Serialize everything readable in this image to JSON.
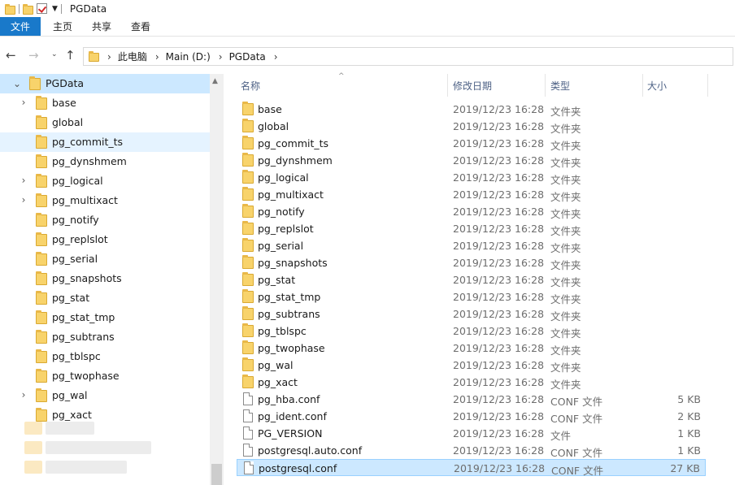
{
  "window": {
    "title": "PGData"
  },
  "ribbon": {
    "tabs": [
      "文件",
      "主页",
      "共享",
      "查看"
    ]
  },
  "address": {
    "crumbs": [
      "此电脑",
      "Main (D:)",
      "PGData"
    ]
  },
  "colors": {
    "accent": "#1979ca",
    "selection": "#cce8ff",
    "folder": "#f8d36b"
  },
  "nav_pane": {
    "root": "PGData",
    "items": [
      {
        "label": "base",
        "expandable": true
      },
      {
        "label": "global",
        "expandable": false
      },
      {
        "label": "pg_commit_ts",
        "expandable": false,
        "hover": true
      },
      {
        "label": "pg_dynshmem",
        "expandable": false
      },
      {
        "label": "pg_logical",
        "expandable": true
      },
      {
        "label": "pg_multixact",
        "expandable": true
      },
      {
        "label": "pg_notify",
        "expandable": false
      },
      {
        "label": "pg_replslot",
        "expandable": false
      },
      {
        "label": "pg_serial",
        "expandable": false
      },
      {
        "label": "pg_snapshots",
        "expandable": false
      },
      {
        "label": "pg_stat",
        "expandable": false
      },
      {
        "label": "pg_stat_tmp",
        "expandable": false
      },
      {
        "label": "pg_subtrans",
        "expandable": false
      },
      {
        "label": "pg_tblspc",
        "expandable": false
      },
      {
        "label": "pg_twophase",
        "expandable": false
      },
      {
        "label": "pg_wal",
        "expandable": true
      },
      {
        "label": "pg_xact",
        "expandable": false
      }
    ]
  },
  "columns": [
    "名称",
    "修改日期",
    "类型",
    "大小"
  ],
  "files": [
    {
      "name": "base",
      "date": "2019/12/23 16:28",
      "type": "文件夹",
      "size": "",
      "kind": "folder"
    },
    {
      "name": "global",
      "date": "2019/12/23 16:28",
      "type": "文件夹",
      "size": "",
      "kind": "folder"
    },
    {
      "name": "pg_commit_ts",
      "date": "2019/12/23 16:28",
      "type": "文件夹",
      "size": "",
      "kind": "folder"
    },
    {
      "name": "pg_dynshmem",
      "date": "2019/12/23 16:28",
      "type": "文件夹",
      "size": "",
      "kind": "folder"
    },
    {
      "name": "pg_logical",
      "date": "2019/12/23 16:28",
      "type": "文件夹",
      "size": "",
      "kind": "folder"
    },
    {
      "name": "pg_multixact",
      "date": "2019/12/23 16:28",
      "type": "文件夹",
      "size": "",
      "kind": "folder"
    },
    {
      "name": "pg_notify",
      "date": "2019/12/23 16:28",
      "type": "文件夹",
      "size": "",
      "kind": "folder"
    },
    {
      "name": "pg_replslot",
      "date": "2019/12/23 16:28",
      "type": "文件夹",
      "size": "",
      "kind": "folder"
    },
    {
      "name": "pg_serial",
      "date": "2019/12/23 16:28",
      "type": "文件夹",
      "size": "",
      "kind": "folder"
    },
    {
      "name": "pg_snapshots",
      "date": "2019/12/23 16:28",
      "type": "文件夹",
      "size": "",
      "kind": "folder"
    },
    {
      "name": "pg_stat",
      "date": "2019/12/23 16:28",
      "type": "文件夹",
      "size": "",
      "kind": "folder"
    },
    {
      "name": "pg_stat_tmp",
      "date": "2019/12/23 16:28",
      "type": "文件夹",
      "size": "",
      "kind": "folder"
    },
    {
      "name": "pg_subtrans",
      "date": "2019/12/23 16:28",
      "type": "文件夹",
      "size": "",
      "kind": "folder"
    },
    {
      "name": "pg_tblspc",
      "date": "2019/12/23 16:28",
      "type": "文件夹",
      "size": "",
      "kind": "folder"
    },
    {
      "name": "pg_twophase",
      "date": "2019/12/23 16:28",
      "type": "文件夹",
      "size": "",
      "kind": "folder"
    },
    {
      "name": "pg_wal",
      "date": "2019/12/23 16:28",
      "type": "文件夹",
      "size": "",
      "kind": "folder"
    },
    {
      "name": "pg_xact",
      "date": "2019/12/23 16:28",
      "type": "文件夹",
      "size": "",
      "kind": "folder"
    },
    {
      "name": "pg_hba.conf",
      "date": "2019/12/23 16:28",
      "type": "CONF 文件",
      "size": "5 KB",
      "kind": "file"
    },
    {
      "name": "pg_ident.conf",
      "date": "2019/12/23 16:28",
      "type": "CONF 文件",
      "size": "2 KB",
      "kind": "file"
    },
    {
      "name": "PG_VERSION",
      "date": "2019/12/23 16:28",
      "type": "文件",
      "size": "1 KB",
      "kind": "file"
    },
    {
      "name": "postgresql.auto.conf",
      "date": "2019/12/23 16:28",
      "type": "CONF 文件",
      "size": "1 KB",
      "kind": "file"
    },
    {
      "name": "postgresql.conf",
      "date": "2019/12/23 16:28",
      "type": "CONF 文件",
      "size": "27 KB",
      "kind": "file",
      "selected": true
    }
  ]
}
